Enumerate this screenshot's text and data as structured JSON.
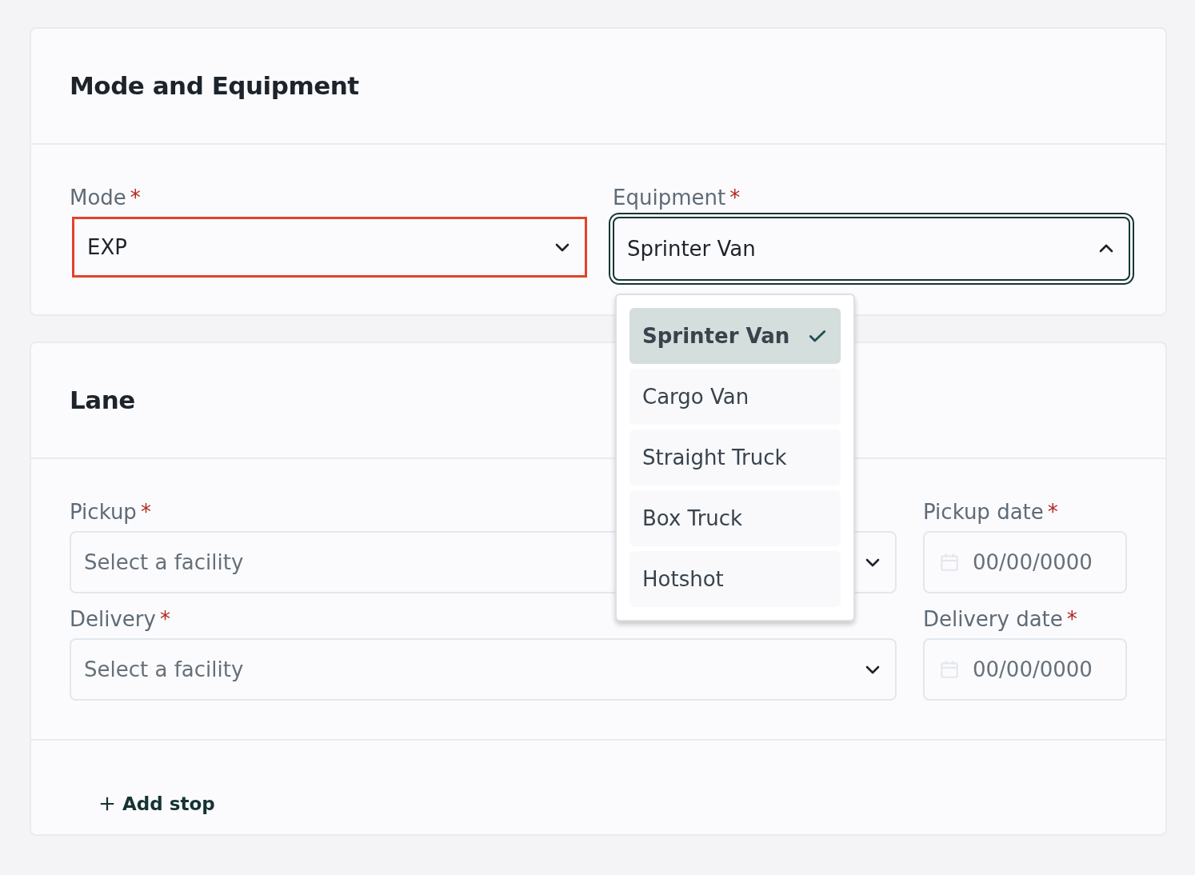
{
  "mode_equipment": {
    "title": "Mode and Equipment",
    "mode": {
      "label": "Mode",
      "required_mark": "*",
      "value": "EXP",
      "invalid": true,
      "expanded": false
    },
    "equipment": {
      "label": "Equipment",
      "required_mark": "*",
      "value": "Sprinter Van",
      "invalid": false,
      "expanded": true,
      "options": [
        {
          "label": "Sprinter Van",
          "selected": true
        },
        {
          "label": "Cargo Van",
          "selected": false
        },
        {
          "label": "Straight Truck",
          "selected": false
        },
        {
          "label": "Box Truck",
          "selected": false
        },
        {
          "label": "Hotshot",
          "selected": false
        }
      ]
    }
  },
  "lane": {
    "title": "Lane",
    "stops": [
      {
        "facility": {
          "label": "Pickup",
          "required_mark": "*",
          "placeholder": "Select a facility"
        },
        "date": {
          "label": "Pickup date",
          "required_mark": "*",
          "placeholder": "00/00/0000"
        }
      },
      {
        "facility": {
          "label": "Delivery",
          "required_mark": "*",
          "placeholder": "Select a facility"
        },
        "date": {
          "label": "Delivery date",
          "required_mark": "*",
          "placeholder": "00/00/0000"
        }
      }
    ],
    "add_stop": "Add stop"
  }
}
